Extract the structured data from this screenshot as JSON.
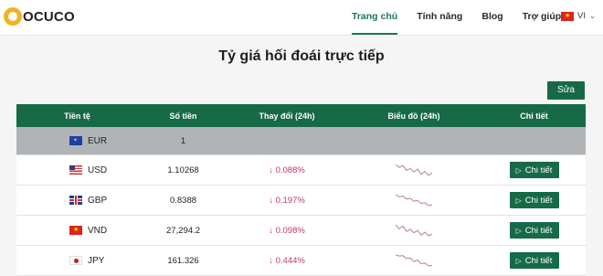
{
  "header": {
    "logo_text": "OCUCO",
    "nav": [
      {
        "label": "Trang chủ",
        "active": true
      },
      {
        "label": "Tính năng",
        "active": false
      },
      {
        "label": "Blog",
        "active": false
      },
      {
        "label": "Trợ giúp",
        "active": false
      }
    ],
    "language": "VI"
  },
  "page": {
    "title": "Tỷ giá hối đoái trực tiếp",
    "edit_label": "Sửa"
  },
  "table": {
    "headers": [
      "Tiền tệ",
      "Số tiền",
      "Thay đổi (24h)",
      "Biểu đồ (24h)",
      "Chi tiết"
    ],
    "rows": [
      {
        "code": "EUR",
        "flag": "eu-flag",
        "amount": "1",
        "change": "",
        "detail": "",
        "sparkline": []
      },
      {
        "code": "USD",
        "flag": "us-flag",
        "amount": "1.10268",
        "change": "↓ 0.088%",
        "detail": "Chi tiết",
        "sparkline": [
          1.1041,
          1.1036,
          1.1039,
          1.1031,
          1.1034,
          1.1028,
          1.1033,
          1.1024,
          1.1029,
          1.1022,
          1.1027
        ]
      },
      {
        "code": "GBP",
        "flag": "gb-flag",
        "amount": "0.8388",
        "change": "↓ 0.197%",
        "detail": "Chi tiết",
        "sparkline": [
          0.8402,
          0.8399,
          0.84,
          0.8396,
          0.8397,
          0.8393,
          0.8394,
          0.839,
          0.8391,
          0.8387,
          0.8388
        ]
      },
      {
        "code": "VND",
        "flag": "vn-flag",
        "amount": "27,294.2",
        "change": "↓ 0.098%",
        "detail": "Chi tiết",
        "sparkline": [
          27322,
          27310,
          27318,
          27302,
          27309,
          27298,
          27305,
          27291,
          27300,
          27289,
          27294
        ]
      },
      {
        "code": "JPY",
        "flag": "jp-flag",
        "amount": "161.326",
        "change": "↓ 0.444%",
        "detail": "Chi tiết",
        "sparkline": [
          162.05,
          161.98,
          162.0,
          161.8,
          161.85,
          161.6,
          161.7,
          161.45,
          161.5,
          161.3,
          161.33
        ]
      }
    ]
  },
  "colors": {
    "brand_green": "#166a47",
    "negative": "#c0395f",
    "sparkline": "#c07a99",
    "base_row": "#b1b4b6"
  }
}
